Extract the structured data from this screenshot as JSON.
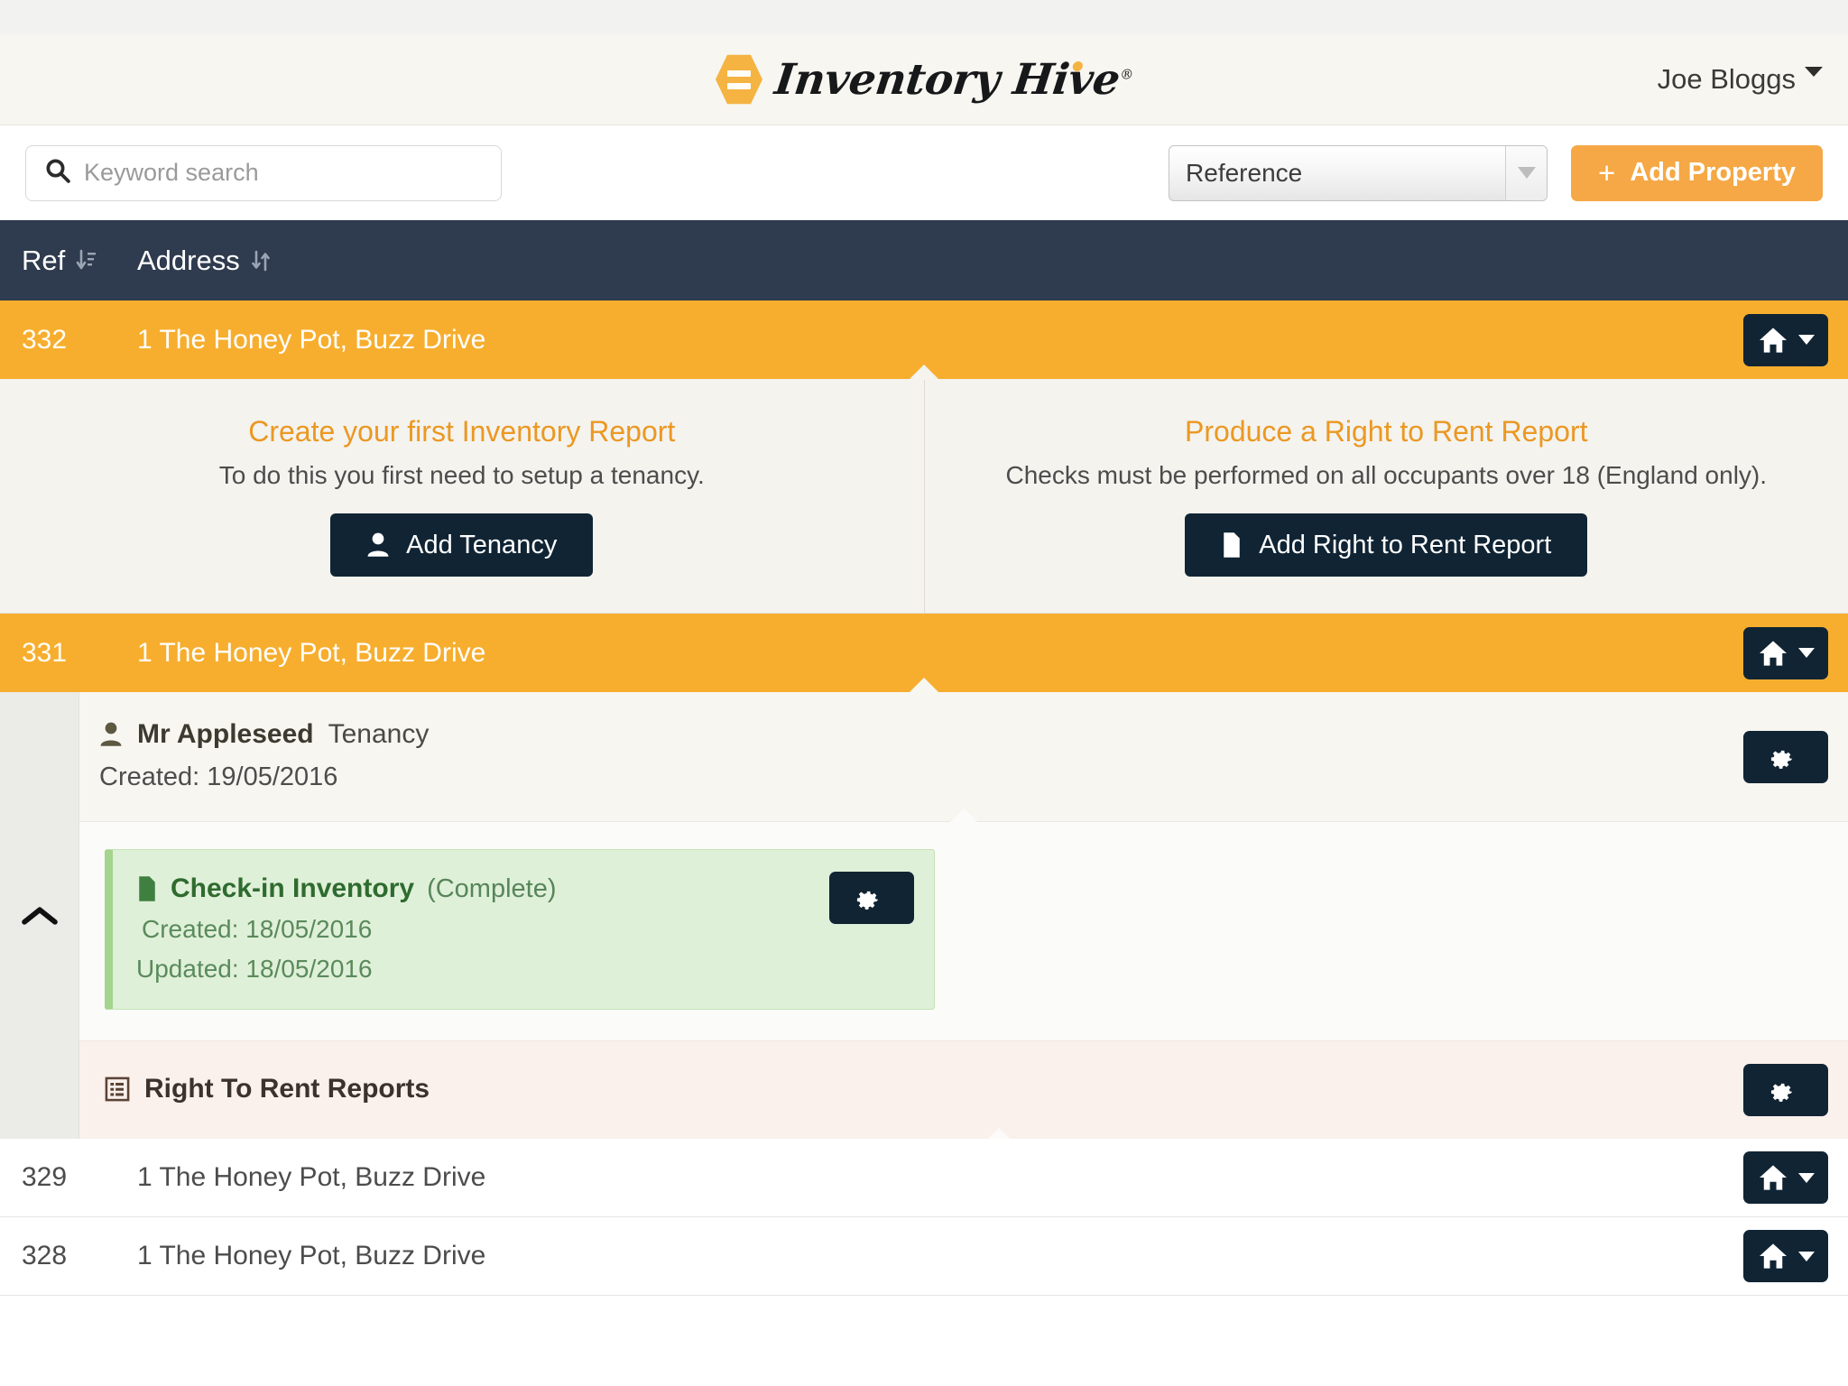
{
  "header": {
    "brand": "Inventory Hive",
    "brand_registered": "®",
    "user": "Joe Bloggs"
  },
  "toolbar": {
    "search_placeholder": "Keyword search",
    "search_value": "",
    "sort_select_value": "Reference",
    "add_property_label": "Add Property",
    "add_property_plus": "+",
    "accent_color": "#f5a845"
  },
  "table": {
    "columns": [
      {
        "label": "Ref",
        "sort_icon": "sort-desc-icon"
      },
      {
        "label": "Address",
        "sort_icon": "sort-icon"
      }
    ]
  },
  "rows": [
    {
      "ref": "332",
      "address": "1 The Honey Pot, Buzz Drive",
      "expanded": true,
      "action_icon": "home-icon"
    },
    {
      "ref": "331",
      "address": "1 The Honey Pot, Buzz Drive",
      "expanded": true,
      "action_icon": "home-icon"
    },
    {
      "ref": "329",
      "address": "1 The Honey Pot, Buzz Drive",
      "expanded": false,
      "action_icon": "home-icon"
    },
    {
      "ref": "328",
      "address": "1 The Honey Pot, Buzz Drive",
      "expanded": false,
      "action_icon": "home-icon"
    }
  ],
  "cta_panel": {
    "left": {
      "title": "Create your first Inventory Report",
      "subtitle": "To do this you first need to setup a tenancy.",
      "button_label": "Add Tenancy",
      "button_icon": "user-icon"
    },
    "right": {
      "title": "Produce a Right to Rent Report",
      "subtitle": "Checks must be performed on all occupants over 18 (England only).",
      "button_label": "Add Right to Rent Report",
      "button_icon": "document-icon"
    }
  },
  "tenancy": {
    "tenant_name": "Mr Appleseed",
    "tenant_suffix": "Tenancy",
    "created": "Created: 19/05/2016",
    "gear_icon": "gear-icon",
    "report": {
      "title": "Check-in Inventory",
      "status": "(Complete)",
      "created": "Created: 18/05/2016",
      "updated": "Updated: 18/05/2016",
      "icon": "document-icon",
      "gear_icon": "gear-icon"
    },
    "right_to_rent": {
      "title": "Right To Rent Reports",
      "icon": "list-icon",
      "gear_icon": "gear-icon"
    },
    "collapse_icon": "chevron-up-icon"
  }
}
